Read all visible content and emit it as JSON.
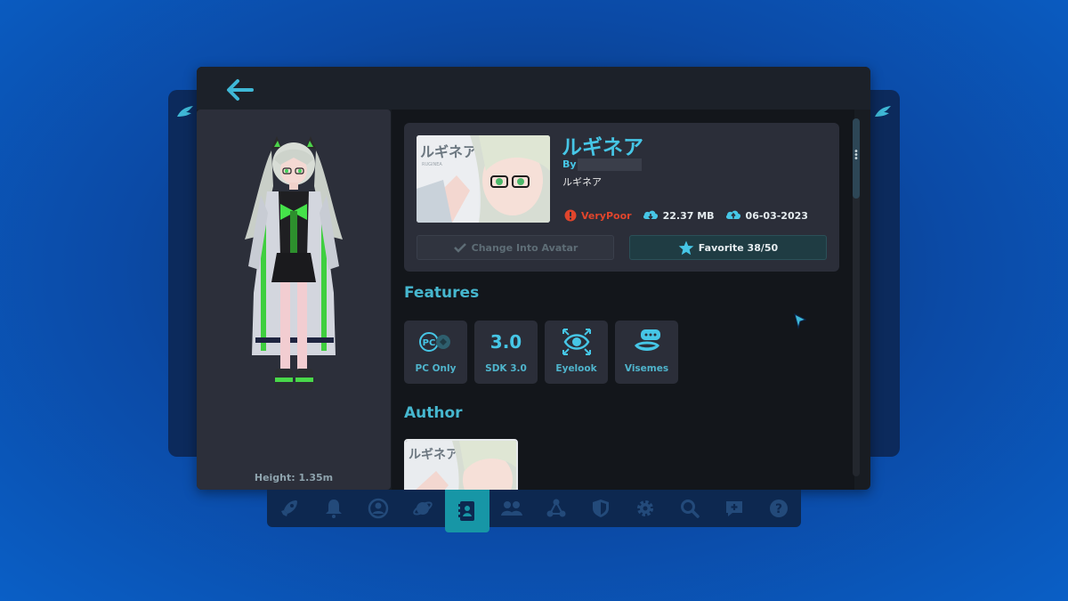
{
  "colors": {
    "accent": "#46c6e6",
    "performance_poor": "#e0452c",
    "taskbar_active": "#1796a6"
  },
  "header": {
    "back_icon": "arrow-left-icon"
  },
  "preview": {
    "height_label": "Height: 1.35m"
  },
  "avatar": {
    "name": "ルギネア",
    "by_label": "By",
    "author_name_redacted": true,
    "description": "ルギネア",
    "thumbnail_title": "ルギネア",
    "thumbnail_subtitle": "RUGINEA",
    "performance": "VeryPoor",
    "size": "22.37 MB",
    "date": "06-03-2023"
  },
  "actions": {
    "change_label": "Change Into Avatar",
    "favorite_label": "Favorite 38/50"
  },
  "features": {
    "title": "Features",
    "items": [
      {
        "label": "PC Only",
        "icon": "pc-only-icon"
      },
      {
        "label": "SDK 3.0",
        "icon": "sdk-icon",
        "icon_text": "3.0"
      },
      {
        "label": "Eyelook",
        "icon": "eye-icon"
      },
      {
        "label": "Visemes",
        "icon": "visemes-icon"
      }
    ]
  },
  "author": {
    "title": "Author"
  },
  "taskbar": {
    "items": [
      "launch",
      "notifications",
      "profile",
      "worlds",
      "avatars",
      "social",
      "groups",
      "safety",
      "settings",
      "search",
      "add-message",
      "help"
    ],
    "active_index": 4
  }
}
